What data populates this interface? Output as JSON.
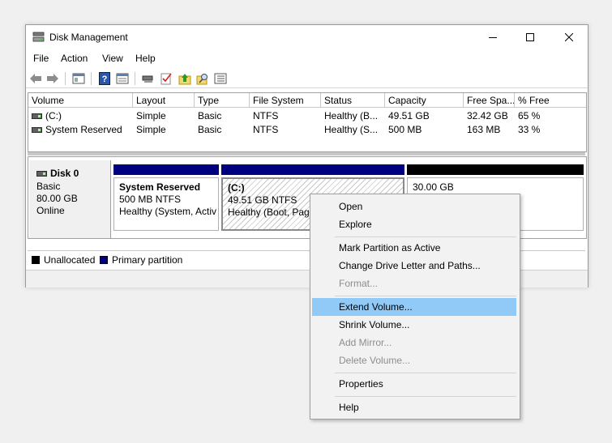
{
  "window": {
    "title": "Disk Management"
  },
  "menu": [
    "File",
    "Action",
    "View",
    "Help"
  ],
  "toolbar_icons": [
    "back-arrow-icon",
    "forward-arrow-icon",
    "console-tree-icon",
    "help-icon",
    "properties-icon",
    "connect-icon",
    "check-icon",
    "up-icon",
    "search-icon",
    "list-icon"
  ],
  "table": {
    "headers": [
      "Volume",
      "Layout",
      "Type",
      "File System",
      "Status",
      "Capacity",
      "Free Spa...",
      "% Free"
    ],
    "rows": [
      [
        "(C:)",
        "Simple",
        "Basic",
        "NTFS",
        "Healthy (B...",
        "49.51 GB",
        "32.42 GB",
        "65 %"
      ],
      [
        "System Reserved",
        "Simple",
        "Basic",
        "NTFS",
        "Healthy (S...",
        "500 MB",
        "163 MB",
        "33 %"
      ]
    ]
  },
  "disk": {
    "name": "Disk 0",
    "type": "Basic",
    "size": "80.00 GB",
    "state": "Online"
  },
  "partitions": [
    {
      "name": "System Reserved",
      "size": "500 MB NTFS",
      "status": "Healthy (System, Activ"
    },
    {
      "name": "(C:)",
      "size": "49.51 GB NTFS",
      "status": "Healthy (Boot, Page"
    },
    {
      "name": "",
      "size": "30.00 GB",
      "status": ""
    }
  ],
  "legend": [
    "Unallocated",
    "Primary partition"
  ],
  "colors": {
    "primary": "#00007f",
    "unallocated": "#000000",
    "highlight": "#91c9f7"
  },
  "context_menu": [
    {
      "label": "Open",
      "enabled": true
    },
    {
      "label": "Explore",
      "enabled": true
    },
    {
      "label": "Mark Partition as Active",
      "enabled": true
    },
    {
      "label": "Change Drive Letter and Paths...",
      "enabled": true
    },
    {
      "label": "Format...",
      "enabled": false
    },
    {
      "label": "Extend Volume...",
      "enabled": true,
      "highlighted": true
    },
    {
      "label": "Shrink Volume...",
      "enabled": true
    },
    {
      "label": "Add Mirror...",
      "enabled": false
    },
    {
      "label": "Delete Volume...",
      "enabled": false
    },
    {
      "label": "Properties",
      "enabled": true
    },
    {
      "label": "Help",
      "enabled": true
    }
  ]
}
